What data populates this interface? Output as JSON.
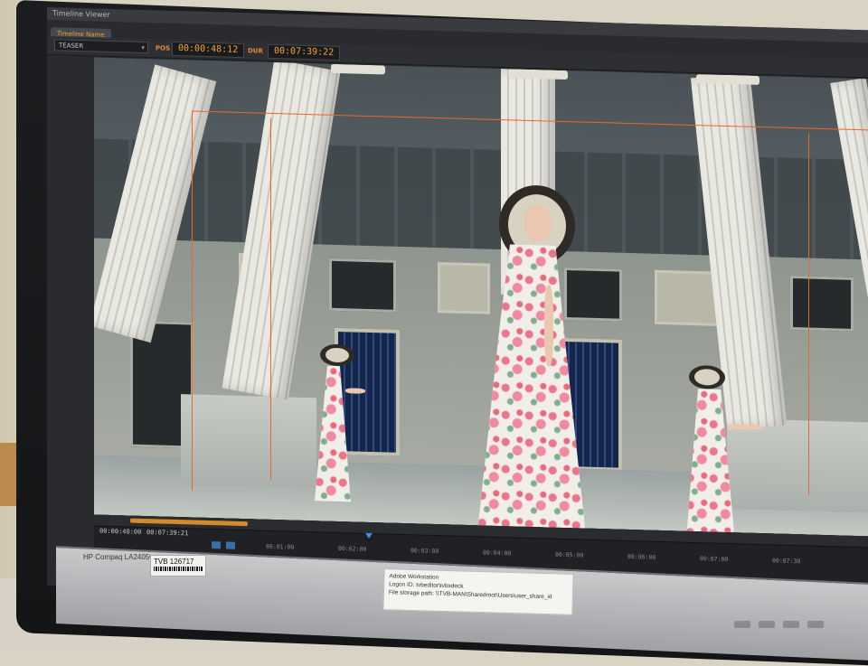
{
  "app": {
    "window_title": "Timeline Viewer"
  },
  "tabs": [
    {
      "label": "Timeline Name"
    }
  ],
  "toolbar": {
    "sequence": "TEASER",
    "pos_label": "POS",
    "pos_value": "00:00:48:12",
    "dur_label": "DUR",
    "dur_value": "00:07:39:22"
  },
  "timeline": {
    "start_tc": "00:00:48:00",
    "start_tc2": "00:07:39:21",
    "ticks": [
      "00:01:00",
      "00:02:00",
      "00:03:00",
      "00:04:00",
      "00:05:00",
      "00:06:00",
      "00:07:00",
      "00:07:30"
    ]
  },
  "monitor": {
    "brand_label": "HP Compaq LA2405wg",
    "asset_tag_title": "TVB",
    "asset_tag_number": "126717",
    "note_lines": [
      "Adobe Workstation",
      "Logon ID: tvbeditor\\tvbsdeck",
      "File storage path: \\\\TVB-MAN\\Sharedroot\\Users\\user_share_id"
    ]
  },
  "colors": {
    "overlay_guide": "#e8682a",
    "timecode": "#f0a040",
    "playhead": "#3a8ee6"
  }
}
